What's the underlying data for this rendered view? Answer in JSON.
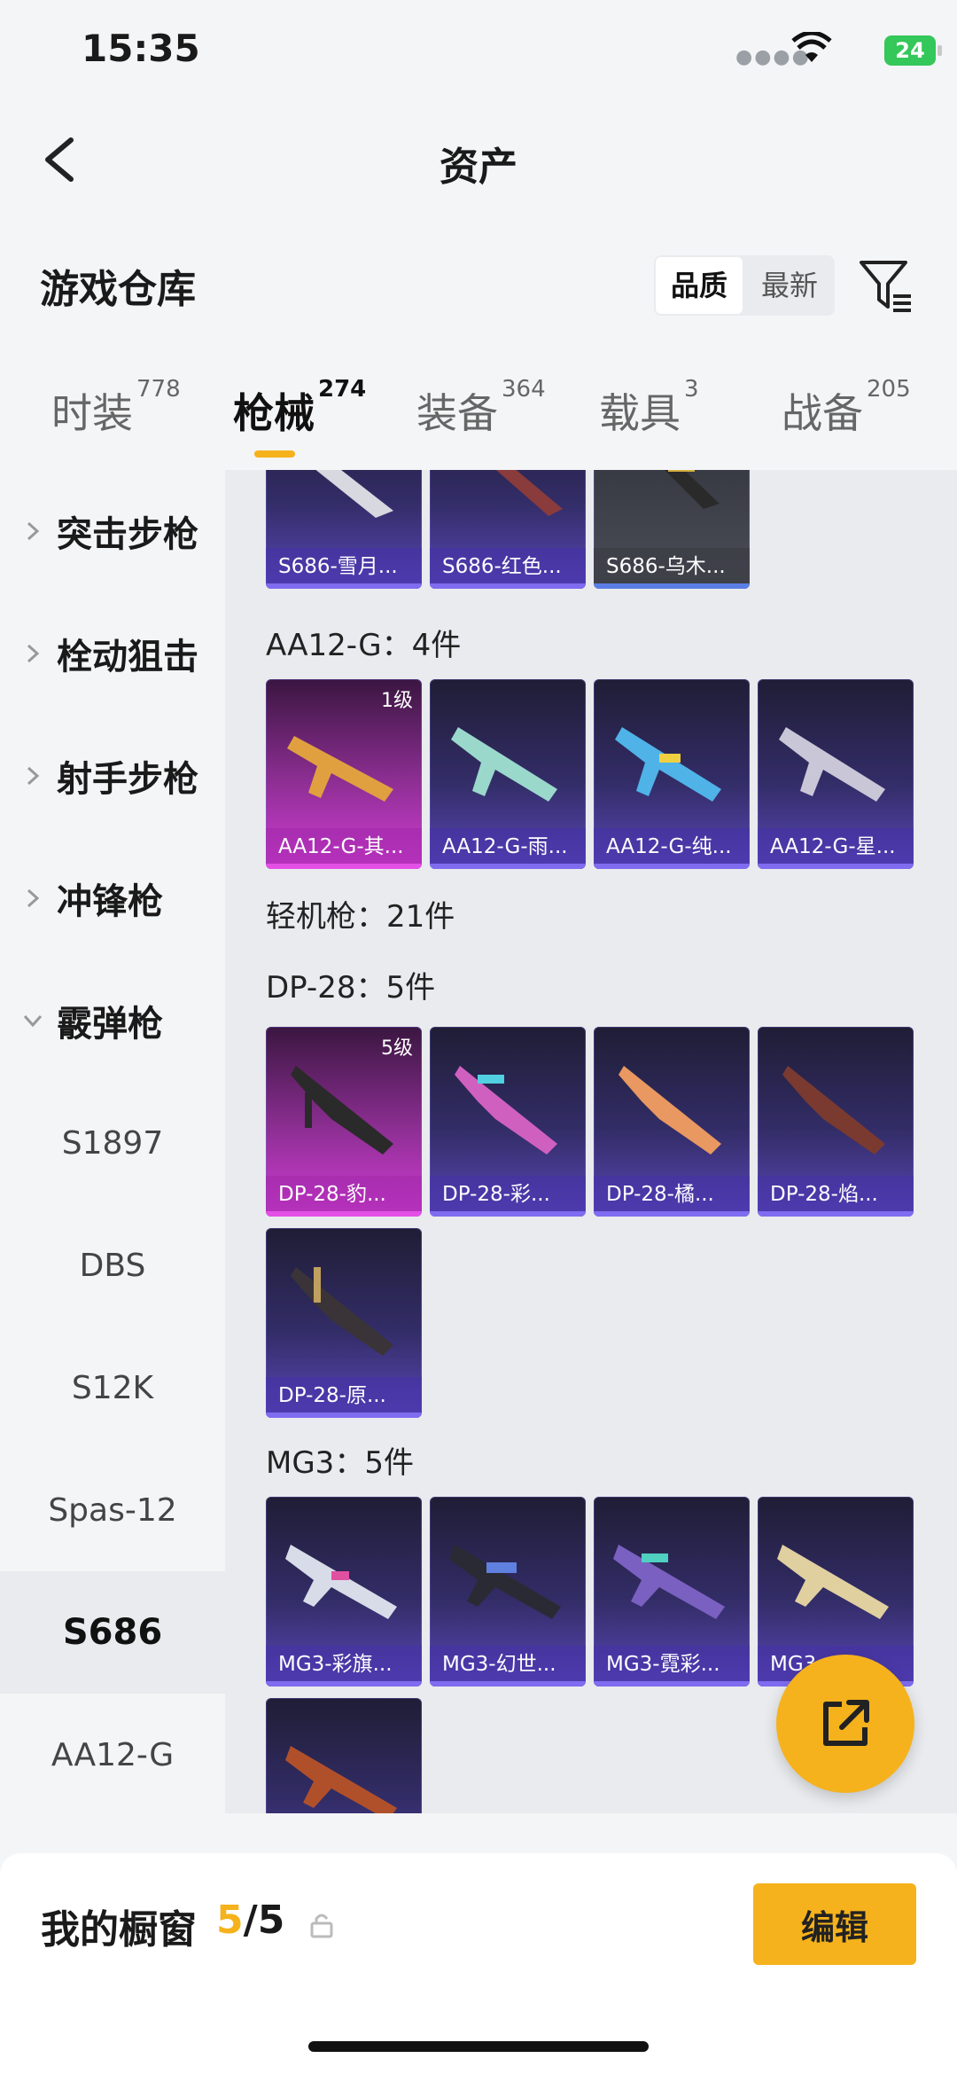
{
  "status_bar": {
    "time": "15:35",
    "battery": "24"
  },
  "header": {
    "title": "资产"
  },
  "section": {
    "title": "游戏仓库",
    "sort_options": [
      "品质",
      "最新"
    ]
  },
  "tabs": [
    {
      "label": "时装",
      "count": "778"
    },
    {
      "label": "枪械",
      "count": "274"
    },
    {
      "label": "装备",
      "count": "364"
    },
    {
      "label": "载具",
      "count": "3"
    },
    {
      "label": "战备",
      "count": "205"
    }
  ],
  "sidebar": {
    "categories": [
      "突击步枪",
      "栓动狙击",
      "射手步枪",
      "冲锋枪",
      "霰弹枪"
    ],
    "subitems": [
      "S1897",
      "DBS",
      "S12K",
      "Spas-12",
      "S686",
      "AA12-G"
    ]
  },
  "content": {
    "s686_cards": [
      "S686-雪月...",
      "S686-红色...",
      "S686-乌木..."
    ],
    "aa12_title": "AA12-G：4件",
    "aa12_cards": [
      {
        "name": "AA12-G-其...",
        "level": "1级"
      },
      {
        "name": "AA12-G-雨..."
      },
      {
        "name": "AA12-G-纯..."
      },
      {
        "name": "AA12-G-星..."
      }
    ],
    "lmg_title": "轻机枪：21件",
    "dp28_title": "DP-28：5件",
    "dp28_cards": [
      {
        "name": "DP-28-豹...",
        "level": "5级"
      },
      {
        "name": "DP-28-彩..."
      },
      {
        "name": "DP-28-橘..."
      },
      {
        "name": "DP-28-焰..."
      },
      {
        "name": "DP-28-原..."
      }
    ],
    "mg3_title": "MG3：5件",
    "mg3_cards": [
      "MG3-彩旗...",
      "MG3-幻世...",
      "MG3-霓彩...",
      "MG3-..."
    ]
  },
  "bottom": {
    "label": "我的橱窗",
    "current": "5",
    "total": "/5",
    "edit_label": "编辑"
  },
  "colors": {
    "accent": "#f5b21c",
    "card_purple": "#5a47b8",
    "card_pink": "#d23dd5"
  }
}
